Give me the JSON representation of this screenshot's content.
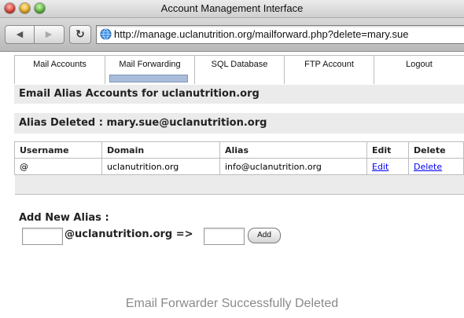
{
  "window": {
    "title": "Account Management Interface",
    "url": "http://manage.uclanutrition.org/mailforward.php?delete=mary.sue"
  },
  "nav": {
    "items": [
      {
        "label": "Mail Accounts"
      },
      {
        "label": "Mail Forwarding"
      },
      {
        "label": "SQL Database"
      },
      {
        "label": "FTP Account"
      },
      {
        "label": "Logout"
      }
    ],
    "active": "Mail Forwarding"
  },
  "main": {
    "section_title": "Email Alias Accounts for uclanutrition.org",
    "deleted_message": "Alias Deleted : mary.sue@uclanutrition.org",
    "table": {
      "headers": [
        "Username",
        "Domain",
        "Alias",
        "Edit",
        "Delete"
      ],
      "rows": [
        {
          "username": "@",
          "domain": "uclanutrition.org",
          "alias": "info@uclanutrition.org",
          "edit": "Edit",
          "delete": "Delete"
        }
      ]
    },
    "add_alias": {
      "title": "Add New Alias :",
      "domain_text": "@uclanutrition.org =>",
      "username_value": "",
      "target_value": "",
      "button_label": "Add"
    }
  },
  "status_text": "Email Forwarder Successfully Deleted",
  "colors": {
    "nav_indicator": "#a9bcd9",
    "section_bg": "#ebebeb",
    "link": "#0000ee"
  },
  "icons": {
    "back": "left-arrow-icon",
    "forward": "right-arrow-icon",
    "reload": "reload-icon",
    "site": "globe-icon"
  }
}
